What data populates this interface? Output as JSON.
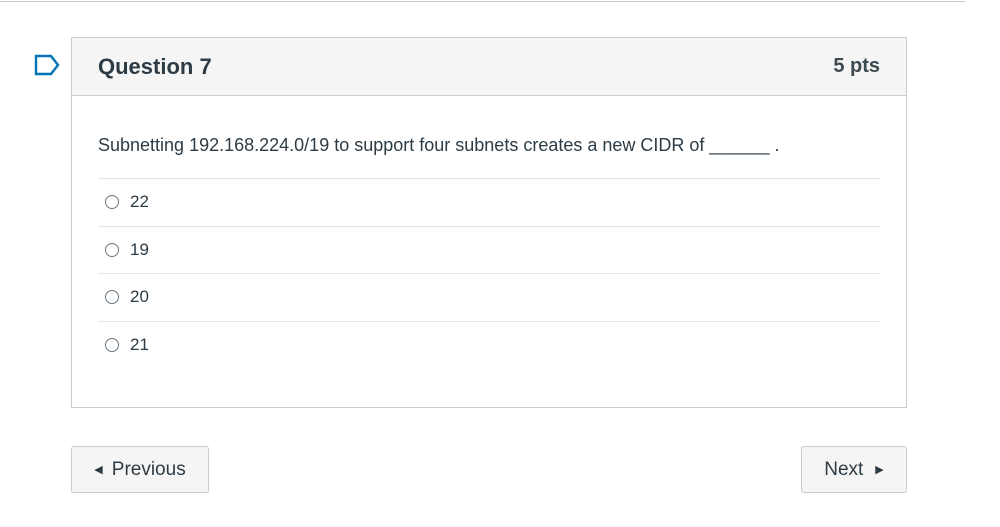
{
  "question": {
    "title": "Question 7",
    "points": "5 pts",
    "text": "Subnetting 192.168.224.0/19 to support four subnets creates a new CIDR of ______ .",
    "flag_icon": "flag-outline-icon",
    "answers": [
      {
        "label": "22",
        "selected": false
      },
      {
        "label": "19",
        "selected": false
      },
      {
        "label": "20",
        "selected": false
      },
      {
        "label": "21",
        "selected": false
      }
    ]
  },
  "navigation": {
    "previous_label": "Previous",
    "next_label": "Next",
    "previous_icon": "triangle-left-icon",
    "next_icon": "triangle-right-icon"
  },
  "colors": {
    "flag": "#0374b5",
    "text": "#2d3b45",
    "header_bg": "#f5f5f5",
    "border": "#c7cdd1"
  }
}
